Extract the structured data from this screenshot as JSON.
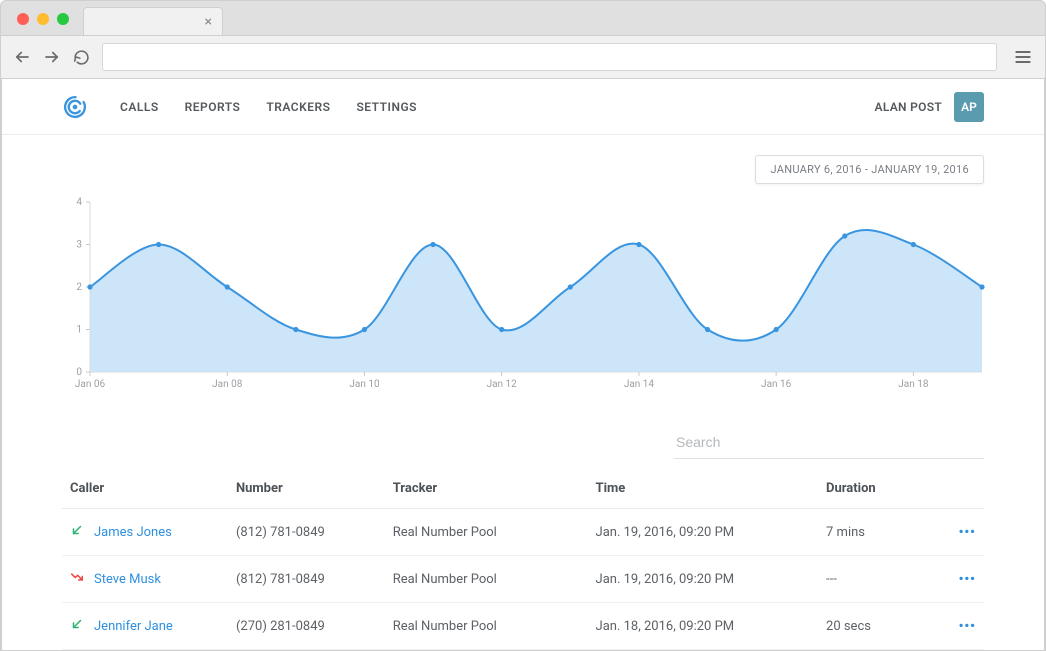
{
  "nav": {
    "items": [
      "CALLS",
      "REPORTS",
      "TRACKERS",
      "SETTINGS"
    ]
  },
  "user": {
    "name": "ALAN POST",
    "initials": "AP"
  },
  "date_range": "JANUARY 6, 2016 - JANUARY 19, 2016",
  "search": {
    "placeholder": "Search"
  },
  "table": {
    "headers": {
      "caller": "Caller",
      "number": "Number",
      "tracker": "Tracker",
      "time": "Time",
      "duration": "Duration"
    },
    "rows": [
      {
        "caller": "James Jones",
        "number": "(812) 781-0849",
        "tracker": "Real Number Pool",
        "time": "Jan. 19, 2016, 09:20 PM",
        "duration": "7 mins",
        "direction": "in-answered"
      },
      {
        "caller": "Steve Musk",
        "number": "(812) 781-0849",
        "tracker": "Real Number Pool",
        "time": "Jan. 19, 2016, 09:20 PM",
        "duration": "---",
        "direction": "missed"
      },
      {
        "caller": "Jennifer Jane",
        "number": "(270) 281-0849",
        "tracker": "Real Number Pool",
        "time": "Jan. 18, 2016, 09:20 PM",
        "duration": "20 secs",
        "direction": "in-answered"
      }
    ]
  },
  "chart_data": {
    "type": "area",
    "title": "",
    "xlabel": "",
    "ylabel": "",
    "ylim": [
      0,
      4
    ],
    "yticks": [
      0,
      1,
      2,
      3,
      4
    ],
    "xticks": [
      "Jan 06",
      "Jan 08",
      "Jan 10",
      "Jan 12",
      "Jan 14",
      "Jan 16",
      "Jan 18"
    ],
    "x": [
      "Jan 06",
      "Jan 07",
      "Jan 08",
      "Jan 09",
      "Jan 10",
      "Jan 11",
      "Jan 12",
      "Jan 13",
      "Jan 14",
      "Jan 15",
      "Jan 16",
      "Jan 17",
      "Jan 18",
      "Jan 19"
    ],
    "values": [
      2,
      3,
      2,
      1,
      1,
      3,
      1,
      2,
      3,
      1,
      1,
      3.2,
      3,
      2
    ],
    "line_color": "#3a95e0",
    "fill_color": "#c4e0f7"
  }
}
